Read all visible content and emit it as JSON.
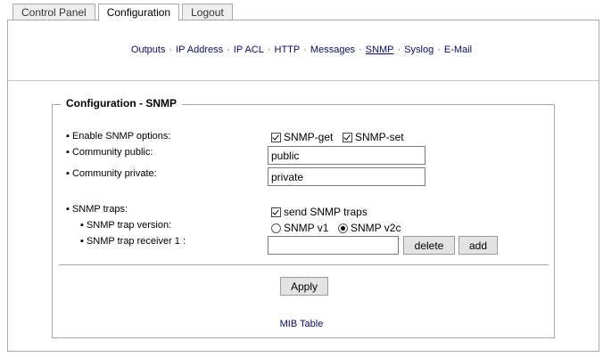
{
  "tabs": [
    {
      "label": "Control Panel",
      "active": false
    },
    {
      "label": "Configuration",
      "active": true
    },
    {
      "label": "Logout",
      "active": false
    }
  ],
  "subnav": {
    "items": [
      "Outputs",
      "IP Address",
      "IP ACL",
      "HTTP",
      "Messages",
      "SNMP",
      "Syslog",
      "E-Mail"
    ],
    "active": "SNMP",
    "separator": "·"
  },
  "section": {
    "title": "Configuration - SNMP"
  },
  "form": {
    "enable_label": "▪ Enable SNMP options:",
    "snmp_get_label": "SNMP-get",
    "snmp_get_checked": true,
    "snmp_set_label": "SNMP-set",
    "snmp_set_checked": true,
    "community_public_label": "▪ Community public:",
    "community_public_value": "public",
    "community_private_label": "▪ Community private:",
    "community_private_value": "private",
    "traps_label": "▪ SNMP traps:",
    "send_traps_label": "send SNMP traps",
    "send_traps_checked": true,
    "trap_version_label": "▪ SNMP trap version:",
    "trap_v1_label": "SNMP v1",
    "trap_v2c_label": "SNMP v2c",
    "trap_version_selected": "SNMP v2c",
    "trap_receiver_label": "▪ SNMP trap receiver 1 :",
    "trap_receiver_value": "",
    "delete_label": "delete",
    "add_label": "add",
    "apply_label": "Apply",
    "mib_link": "MIB Table"
  }
}
